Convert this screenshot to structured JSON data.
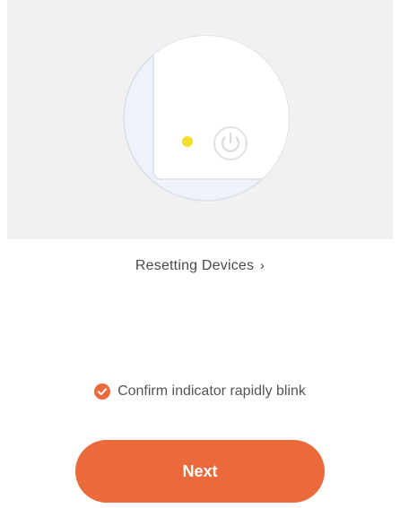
{
  "illustration": {
    "icons": [
      "device-corner",
      "indicator-light",
      "power-icon"
    ],
    "indicator_color": "#f5dd2e"
  },
  "reset_link": {
    "label": "Resetting Devices",
    "chevron": "›"
  },
  "confirm": {
    "checked": true,
    "label": "Confirm indicator rapidly blink"
  },
  "next_button": {
    "label": "Next"
  },
  "colors": {
    "accent": "#ea6a3b",
    "panel_background": "#f1f1f1",
    "text": "#4a4a4a"
  }
}
